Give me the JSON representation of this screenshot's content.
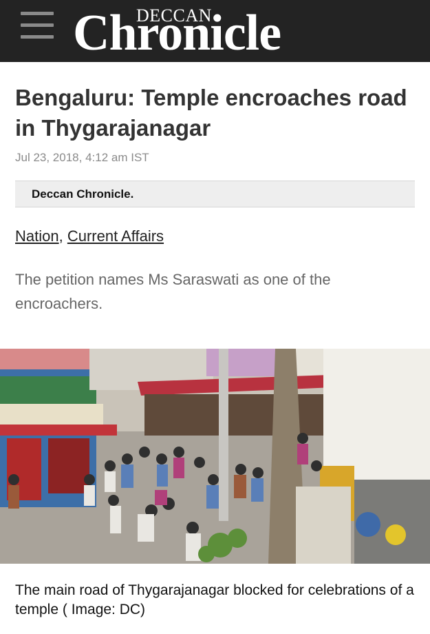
{
  "header": {
    "menu_icon": "hamburger-menu-icon",
    "logo_small": "DECCAN",
    "logo_big": "Chronicle",
    "background": "#232323"
  },
  "article": {
    "title": "Bengaluru: Temple encroaches road in Thygarajanagar",
    "date": "Jul 23, 2018, 4:12 am IST",
    "author": "Deccan Chronicle.",
    "categories": [
      "Nation",
      "Current Affairs"
    ],
    "category_separator": ", ",
    "summary": "The petition names Ms Saraswati as one of the encroachers.",
    "image_caption": "The main road of Thygarajanagar blocked for celebrations of a temple ( Image: DC)"
  }
}
